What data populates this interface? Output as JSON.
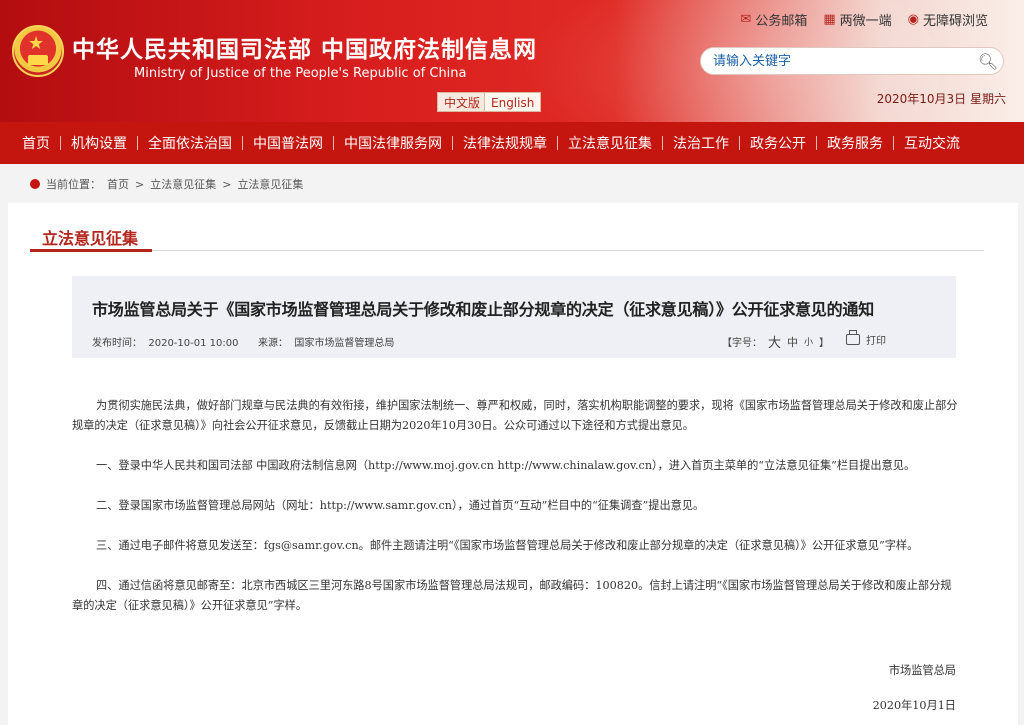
{
  "header": {
    "title_cn": "中华人民共和国司法部  中国政府法制信息网",
    "title_en": "Ministry of Justice of the People's Republic of China",
    "lang_cn": "中文版",
    "lang_en": "English",
    "date": "2020年10月3日  星期六",
    "toplinks": {
      "mail": "公务邮箱",
      "weibo": "两微一端",
      "accessible": "无障碍浏览"
    },
    "search_placeholder": "请输入关键字"
  },
  "nav": [
    "首页",
    "机构设置",
    "全面依法治国",
    "中国普法网",
    "中国法律服务网",
    "法律法规规章",
    "立法意见征集",
    "法治工作",
    "政务公开",
    "政务服务",
    "互动交流"
  ],
  "breadcrumb": {
    "prefix": "当前位置：",
    "home": "首页",
    "sep1": ">",
    "section": "立法意见征集",
    "sep2": ">",
    "current": "立法意见征集"
  },
  "section_title": "立法意见征集",
  "article": {
    "title": "市场监管总局关于《国家市场监督管理总局关于修改和废止部分规章的决定（征求意见稿）》公开征求意见的通知",
    "publish_label": "发布时间：",
    "publish_time": "2020-10-01 10:00",
    "source_label": "来源：",
    "source": "国家市场监督管理总局",
    "font_label": "【字号：",
    "font_big": "大",
    "font_mid": "中",
    "font_small": "小",
    "font_end": "】",
    "print": "打印",
    "paragraphs": [
      "为贯彻实施民法典，做好部门规章与民法典的有效衔接，维护国家法制统一、尊严和权威，同时，落实机构职能调整的要求，现将《国家市场监督管理总局关于修改和废止部分规章的决定（征求意见稿）》向社会公开征求意见，反馈截止日期为2020年10月30日。公众可通过以下途径和方式提出意见。",
      "一、登录中华人民共和国司法部 中国政府法制信息网（http://www.moj.gov.cn  http://www.chinalaw.gov.cn），进入首页主菜单的“立法意见征集”栏目提出意见。",
      "二、登录国家市场监督管理总局网站（网址：http://www.samr.gov.cn），通过首页“互动”栏目中的“征集调查”提出意见。",
      "三、通过电子邮件将意见发送至：fgs@samr.gov.cn。邮件主题请注明“《国家市场监督管理总局关于修改和废止部分规章的决定（征求意见稿）》公开征求意见”字样。",
      "四、通过信函将意见邮寄至：北京市西城区三里河东路8号国家市场监督管理总局法规司，邮政编码：100820。信封上请注明“《国家市场监督管理总局关于修改和废止部分规章的决定（征求意见稿）》公开征求意见”字样。"
    ],
    "signature": "市场监管总局",
    "sign_date": "2020年10月1日"
  }
}
